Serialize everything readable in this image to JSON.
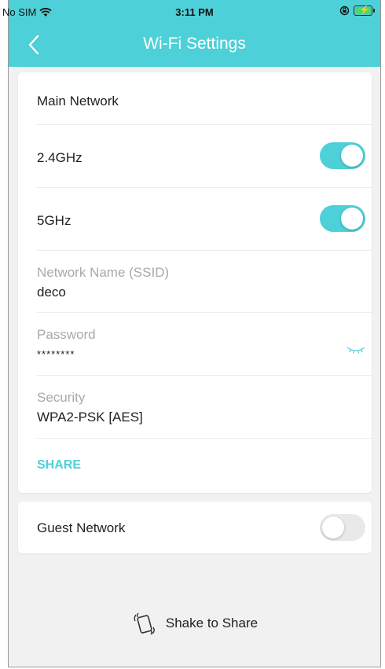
{
  "status_bar": {
    "carrier": "No SIM",
    "time": "3:11 PM"
  },
  "nav": {
    "title": "Wi-Fi Settings"
  },
  "main_network": {
    "header": "Main Network",
    "band_24": {
      "label": "2.4GHz",
      "enabled": true
    },
    "band_5": {
      "label": "5GHz",
      "enabled": true
    },
    "ssid": {
      "label": "Network Name (SSID)",
      "value": "deco"
    },
    "password": {
      "label": "Password",
      "value": "********"
    },
    "security": {
      "label": "Security",
      "value": "WPA2-PSK [AES]"
    },
    "share_label": "SHARE"
  },
  "guest_network": {
    "label": "Guest Network",
    "enabled": false
  },
  "shake": {
    "label": "Shake to Share"
  },
  "colors": {
    "accent": "#4ed0d8",
    "toggle_off": "#e9e9ea",
    "background": "#f1f1f1"
  }
}
